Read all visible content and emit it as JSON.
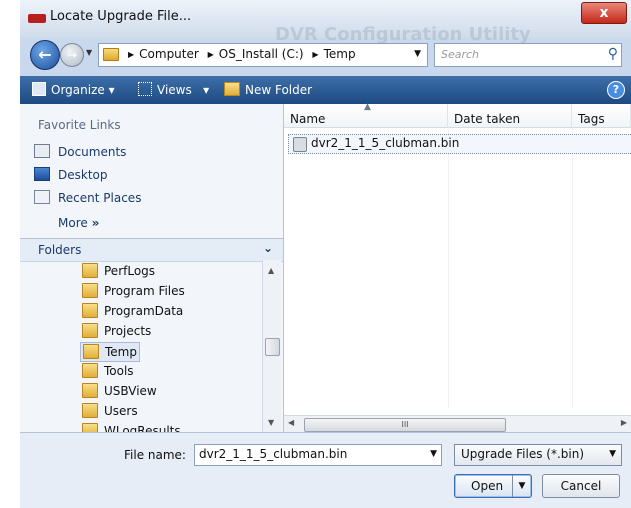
{
  "window": {
    "title": "Locate Upgrade File...",
    "watermark": "DVR Configuration Utility",
    "close_glyph": "x"
  },
  "address": {
    "crumbs": [
      "Computer",
      "OS_Install (C:)",
      "Temp"
    ],
    "search_placeholder": "Search"
  },
  "toolbar": {
    "organize": "Organize",
    "views": "Views",
    "new_folder": "New Folder"
  },
  "favorites": {
    "heading": "Favorite Links",
    "items": [
      "Documents",
      "Desktop",
      "Recent Places"
    ],
    "more": "More"
  },
  "folders": {
    "heading": "Folders",
    "items": [
      "PerfLogs",
      "Program Files",
      "ProgramData",
      "Projects",
      "Temp",
      "Tools",
      "USBView",
      "Users",
      "WLogResults"
    ],
    "selected": "Temp"
  },
  "file_list": {
    "columns": [
      "Name",
      "Date taken",
      "Tags"
    ],
    "files": [
      {
        "name": "dvr2_1_1_5_clubman.bin"
      }
    ],
    "hscroll_grip": "III"
  },
  "bottom": {
    "file_name_label": "File name:",
    "file_name_value": "dvr2_1_1_5_clubman.bin",
    "file_type": "Upgrade Files (*.bin)",
    "open_label": "Open",
    "cancel_label": "Cancel"
  },
  "colors": {
    "toolbar": "#1e4a83",
    "window_frame": "#c9d8ec",
    "close_button": "#c4281b"
  }
}
